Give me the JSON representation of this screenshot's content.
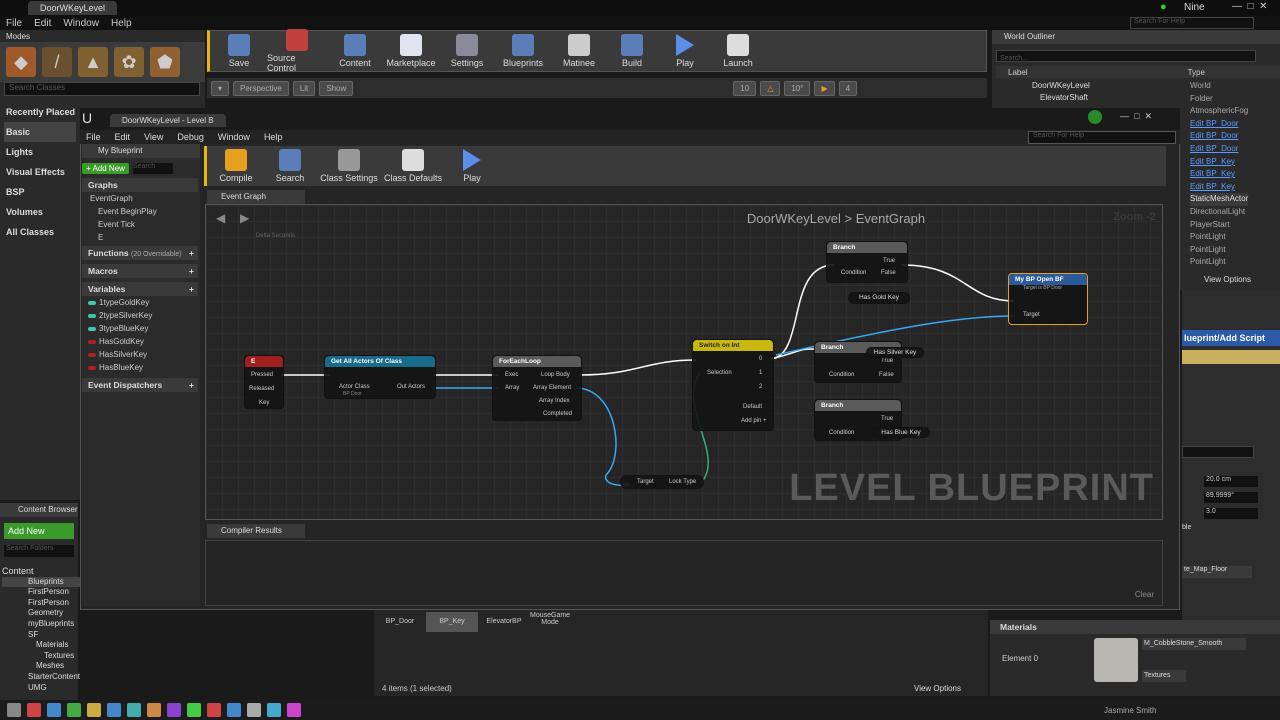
{
  "main": {
    "tab": "DoorWKeyLevel",
    "user": "Nine",
    "search_help": "Search For Help",
    "menu": [
      "File",
      "Edit",
      "Window",
      "Help"
    ]
  },
  "modes": {
    "tab": "Modes",
    "search": "Search Classes",
    "cats": [
      "Recently Placed",
      "Basic",
      "Lights",
      "Visual Effects",
      "BSP",
      "Volumes",
      "All Classes"
    ]
  },
  "toolbar": [
    "Save",
    "Source Control",
    "Content",
    "Marketplace",
    "Settings",
    "Blueprints",
    "Matinee",
    "Build",
    "Play",
    "Launch"
  ],
  "viewport": {
    "perspective": "Perspective",
    "lit": "Lit",
    "show": "Show",
    "grid": "10",
    "angle": "10°",
    "speed": "4"
  },
  "outliner": {
    "tab": "World Outliner",
    "search": "Search...",
    "col_label": "Label",
    "col_type": "Type",
    "labels": [
      "DoorWKeyLevel",
      "ElevatorShaft"
    ],
    "types": [
      "World",
      "Folder",
      "AtmosphericFog",
      "Edit BP_Door",
      "Edit BP_Door",
      "Edit BP_Door",
      "Edit BP_Key",
      "Edit BP_Key",
      "Edit BP_Key",
      "StaticMeshActor",
      "DirectionalLight",
      "PlayerStart",
      "PointLight",
      "PointLight",
      "PointLight"
    ],
    "view_options": "View Options"
  },
  "details": {
    "add_script": "lueprint/Add Script",
    "z1": "20.0 cm",
    "z2": "89.9999°",
    "z3": "3.0",
    "ble": "ble",
    "map": "te_Map_Floor"
  },
  "bp": {
    "tab": "DoorWKeyLevel - Level B",
    "menu": [
      "File",
      "Edit",
      "View",
      "Debug",
      "Window",
      "Help"
    ],
    "search_help": "Search For Help",
    "toolbar": [
      "Compile",
      "Search",
      "Class Settings",
      "Class Defaults",
      "Play"
    ]
  },
  "mybp": {
    "tab": "My Blueprint",
    "add_new": "+ Add New",
    "search": "Search",
    "graphs": "Graphs",
    "event_graph": "EventGraph",
    "events": [
      "Event BeginPlay",
      "Event Tick",
      "E"
    ],
    "functions": "Functions",
    "functions_count": "(20 Overridable)",
    "macros": "Macros",
    "variables": "Variables",
    "vars": [
      {
        "name": "1typeGoldKey",
        "c": "#3ac8a8"
      },
      {
        "name": "2typeSilverKey",
        "c": "#3ac8a8"
      },
      {
        "name": "3typeBlueKey",
        "c": "#3ac8a8"
      },
      {
        "name": "HasGoldKey",
        "c": "#b02020"
      },
      {
        "name": "HasSilverKey",
        "c": "#b02020"
      },
      {
        "name": "HasBlueKey",
        "c": "#b02020"
      }
    ],
    "dispatchers": "Event Dispatchers"
  },
  "graph": {
    "tab": "Event Graph",
    "crumb1": "DoorWKeyLevel",
    "crumb2": "EventGraph",
    "zoom": "Zoom -2",
    "watermark": "LEVEL BLUEPRINT",
    "delta": "Delta Seconds",
    "n_e": {
      "title": "E",
      "pins": [
        "Pressed",
        "Released",
        "Key"
      ]
    },
    "n_getall": {
      "title": "Get All Actors Of Class",
      "pins": [
        "Actor Class",
        "BP Door",
        "Out Actors"
      ]
    },
    "n_foreach": {
      "title": "ForEachLoop",
      "pins": [
        "Exec",
        "Array",
        "Loop Body",
        "Array Element",
        "Array Index",
        "Completed"
      ]
    },
    "n_switch": {
      "title": "Switch on Int",
      "pins": [
        "Selection",
        "0",
        "1",
        "2",
        "Default",
        "Add pin +"
      ]
    },
    "n_getter": {
      "pins": [
        "Target",
        "Lock Type"
      ]
    },
    "n_branch1": {
      "title": "Branch",
      "pins": [
        "Condition",
        "True",
        "False"
      ],
      "var": "Has Gold Key"
    },
    "n_branch2": {
      "title": "Branch",
      "pins": [
        "Condition",
        "True",
        "False"
      ],
      "var": "Has Silver Key"
    },
    "n_branch3": {
      "title": "Branch",
      "pins": [
        "Condition",
        "True"
      ],
      "var": "Has Blue Key"
    },
    "n_open": {
      "title": "My BP Open BF",
      "sub": "Target is BP Door",
      "pins": [
        "Target"
      ]
    }
  },
  "compiler": {
    "tab": "Compiler Results",
    "clear": "Clear"
  },
  "content": {
    "tab": "Content Browser",
    "add_new": "Add New",
    "search": "Search Folders",
    "tree": [
      "Content",
      "Blueprints",
      "FirstPerson",
      "FirstPerson",
      "Geometry",
      "myBlueprints",
      "SF",
      "Materials",
      "Textures",
      "Meshes",
      "StarterContent",
      "UMG"
    ]
  },
  "assets": {
    "items": [
      "BP_Door",
      "BP_Key",
      "ElevatorBP",
      "MouseGame Mode"
    ],
    "count": "4 items (1 selected)",
    "view_options": "View Options"
  },
  "materials": {
    "title": "Materials",
    "element": "Element 0",
    "material": "M_CobbleStone_Smooth",
    "textures": "Textures"
  },
  "taskbar": {
    "credit": "Jasmine Smith"
  }
}
